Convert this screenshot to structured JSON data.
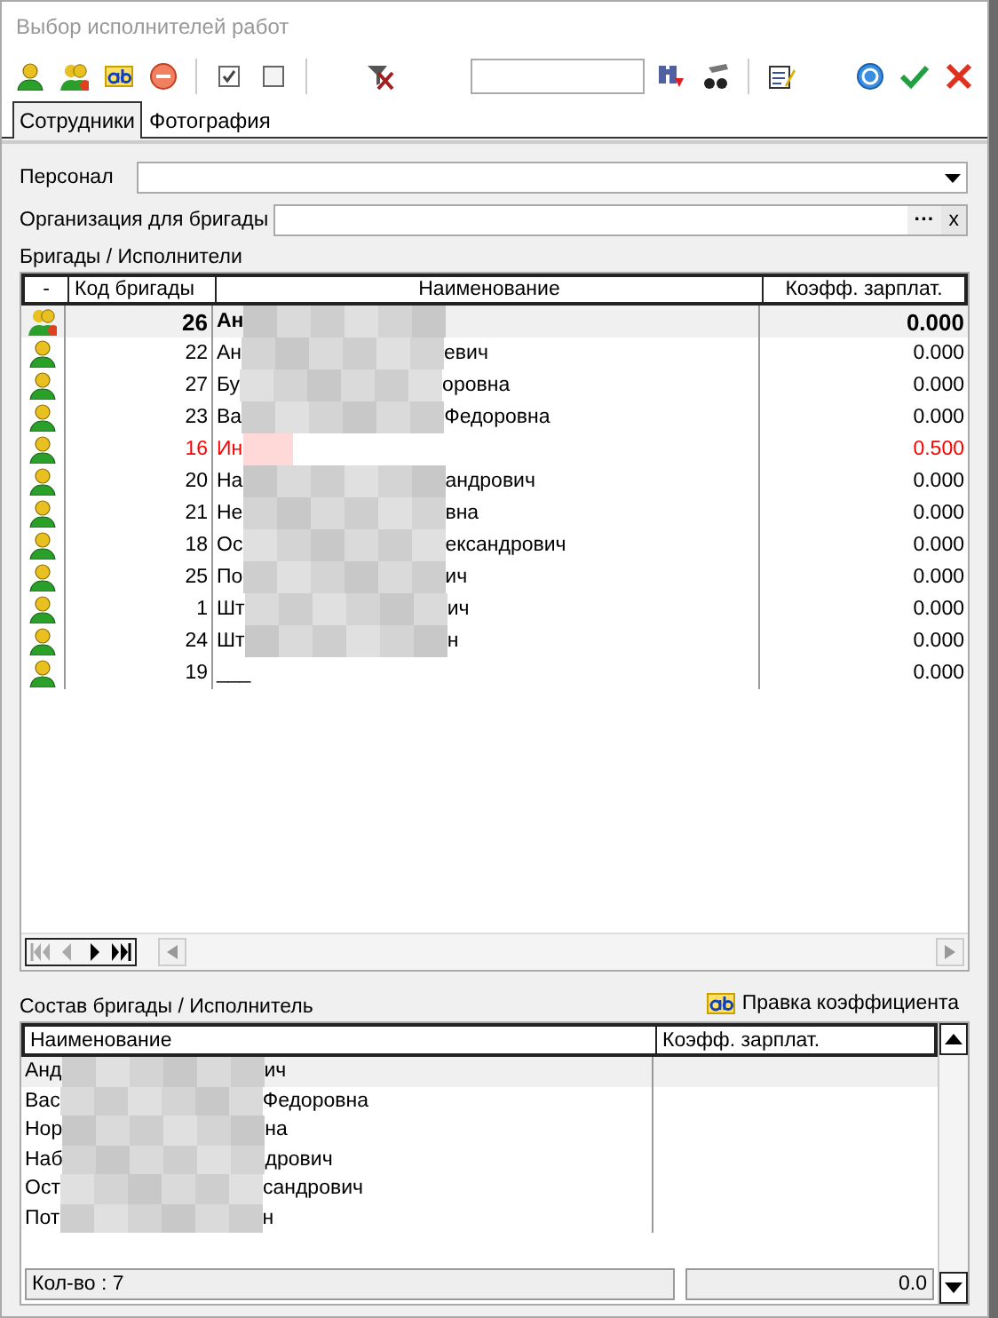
{
  "window": {
    "title": "Выбор исполнителей работ"
  },
  "tabs": [
    {
      "label": "Сотрудники",
      "selected": true
    },
    {
      "label": "Фотография",
      "selected": false
    }
  ],
  "form": {
    "personnel_label": "Персонал",
    "organization_label": "Организация для бригады",
    "browse_button": "···",
    "clear_button": "x"
  },
  "brigades": {
    "title": "Бригады / Исполнители",
    "columns": [
      "-",
      "Код бригады",
      "Наименование",
      "Коэфф. зарплат."
    ],
    "rows": [
      {
        "kind": "brigade",
        "code": "26",
        "name_start": "Ан",
        "name_end": "",
        "coef": "0.000",
        "selected": true,
        "flagged": false,
        "masked": true
      },
      {
        "kind": "person",
        "code": "22",
        "name_start": "Ан",
        "name_end": "евич",
        "coef": "0.000",
        "selected": false,
        "flagged": false,
        "masked": true
      },
      {
        "kind": "person",
        "code": "27",
        "name_start": "Бу",
        "name_end": "оровна",
        "coef": "0.000",
        "selected": false,
        "flagged": false,
        "masked": true
      },
      {
        "kind": "person",
        "code": "23",
        "name_start": "Ва",
        "name_end": "Федоровна",
        "coef": "0.000",
        "selected": false,
        "flagged": false,
        "masked": true
      },
      {
        "kind": "person",
        "code": "16",
        "name_start": "Ин",
        "name_end": "",
        "coef": "0.500",
        "selected": false,
        "flagged": true,
        "masked": true
      },
      {
        "kind": "person",
        "code": "20",
        "name_start": "На",
        "name_end": "андрович",
        "coef": "0.000",
        "selected": false,
        "flagged": false,
        "masked": true
      },
      {
        "kind": "person",
        "code": "21",
        "name_start": "Не",
        "name_end": "вна",
        "coef": "0.000",
        "selected": false,
        "flagged": false,
        "masked": true
      },
      {
        "kind": "person",
        "code": "18",
        "name_start": "Ос",
        "name_end": "ександрович",
        "coef": "0.000",
        "selected": false,
        "flagged": false,
        "masked": true
      },
      {
        "kind": "person",
        "code": "25",
        "name_start": "По",
        "name_end": "ич",
        "coef": "0.000",
        "selected": false,
        "flagged": false,
        "masked": true
      },
      {
        "kind": "person",
        "code": "1",
        "name_start": "Шт",
        "name_end": "ич",
        "coef": "0.000",
        "selected": false,
        "flagged": false,
        "masked": true
      },
      {
        "kind": "person",
        "code": "24",
        "name_start": "Шт",
        "name_end": "н",
        "coef": "0.000",
        "selected": false,
        "flagged": false,
        "masked": true
      },
      {
        "kind": "person",
        "code": "19",
        "name_start": "___",
        "name_end": "",
        "coef": "0.000",
        "selected": false,
        "flagged": false,
        "masked": false
      }
    ],
    "navigator": [
      {
        "kind": "first",
        "disabled": true
      },
      {
        "kind": "prev",
        "disabled": true
      },
      {
        "kind": "next",
        "disabled": false
      },
      {
        "kind": "last",
        "disabled": false
      }
    ]
  },
  "members": {
    "title": "Состав бригады / Исполнитель",
    "edit_button": "Правка коэффициента",
    "columns": [
      "Наименование",
      "Коэфф. зарплат."
    ],
    "rows": [
      {
        "name_start": "Анд",
        "name_end": "ич",
        "selected": true
      },
      {
        "name_start": "Вас",
        "name_end": "Федоровна",
        "selected": false
      },
      {
        "name_start": "Нор",
        "name_end": "на",
        "selected": false
      },
      {
        "name_start": "Наб",
        "name_end": "дрович",
        "selected": false
      },
      {
        "name_start": "Ост",
        "name_end": "сандрович",
        "selected": false
      },
      {
        "name_start": "Пот",
        "name_end": "н",
        "selected": false
      }
    ],
    "count": "Кол-во : 7",
    "total": "0.0"
  }
}
